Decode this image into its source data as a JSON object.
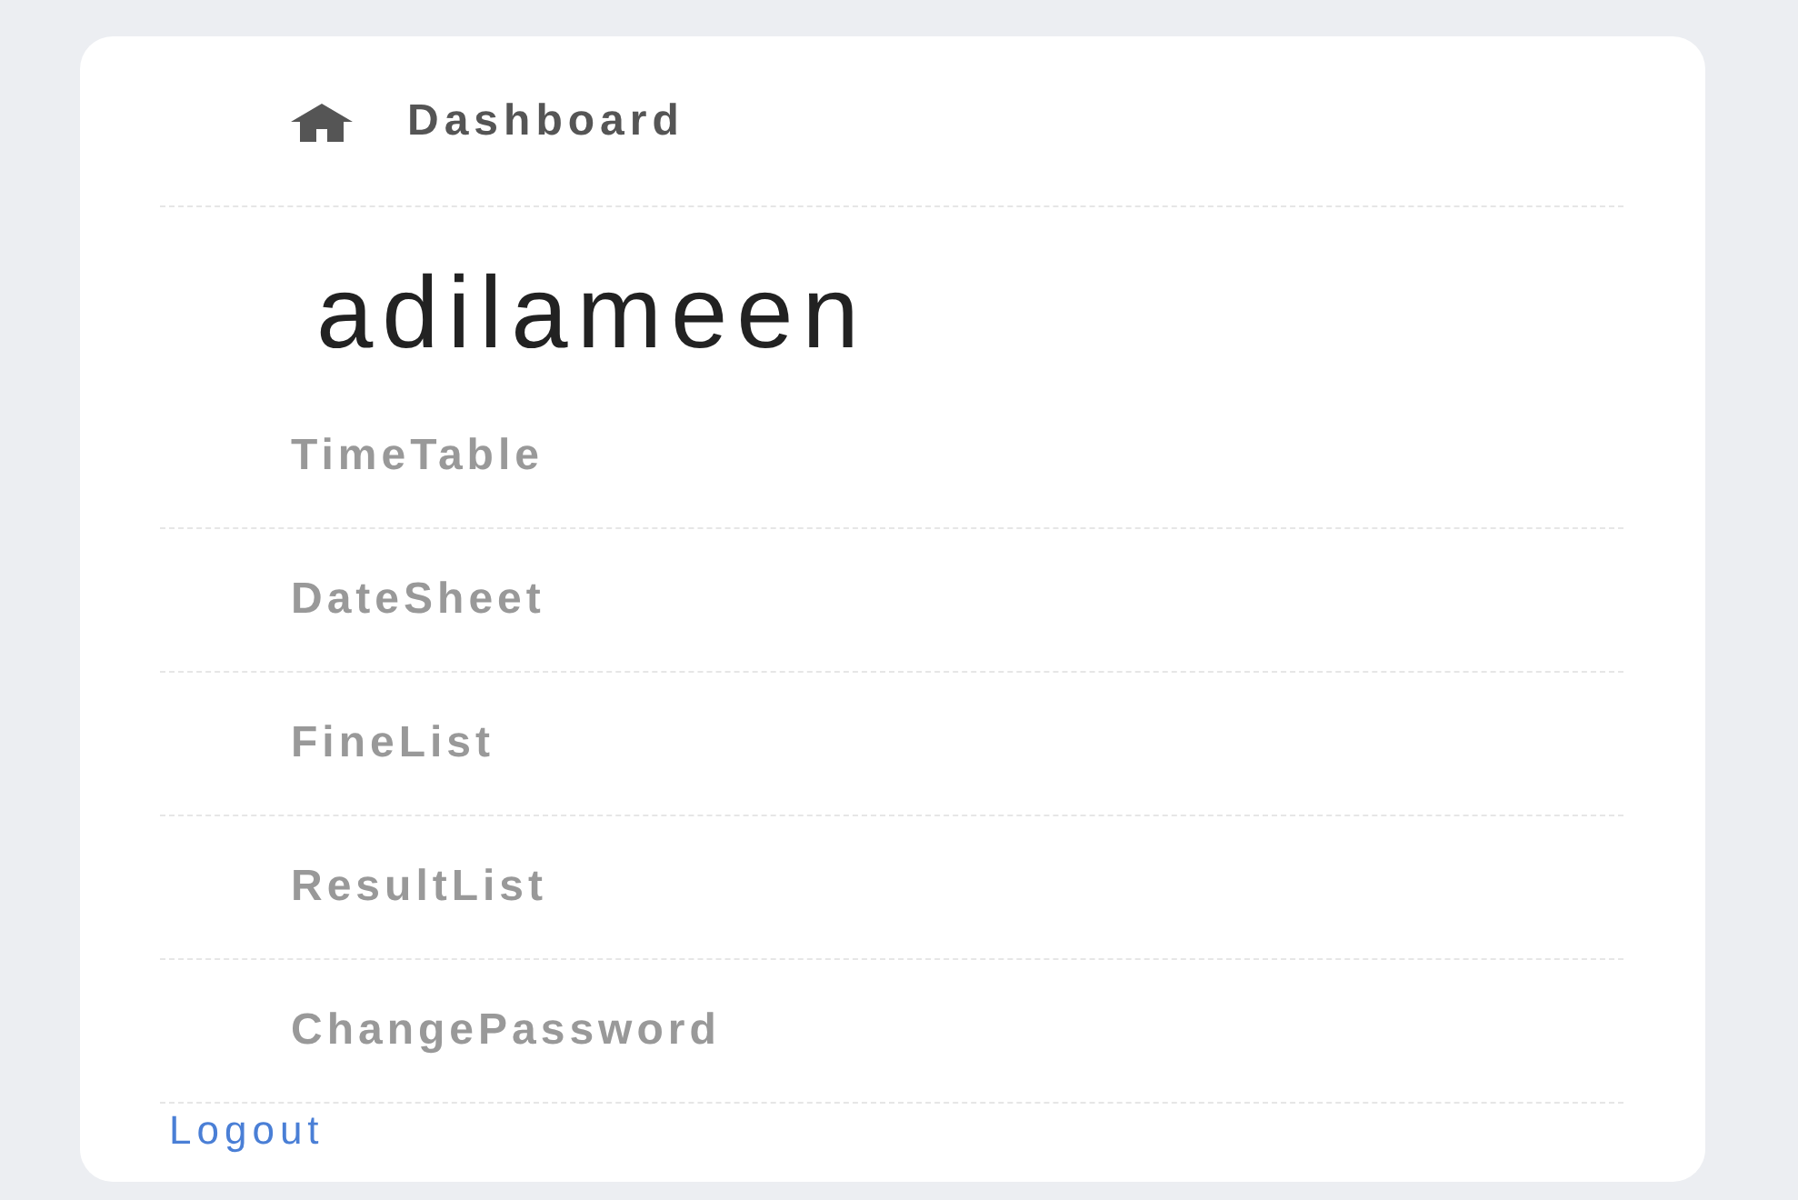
{
  "header": {
    "label": "Dashboard"
  },
  "username": "adilameen",
  "menu": [
    {
      "label": "TimeTable"
    },
    {
      "label": "DateSheet"
    },
    {
      "label": "FineList"
    },
    {
      "label": "ResultList"
    },
    {
      "label": "ChangePassword"
    }
  ],
  "logout": "Logout"
}
